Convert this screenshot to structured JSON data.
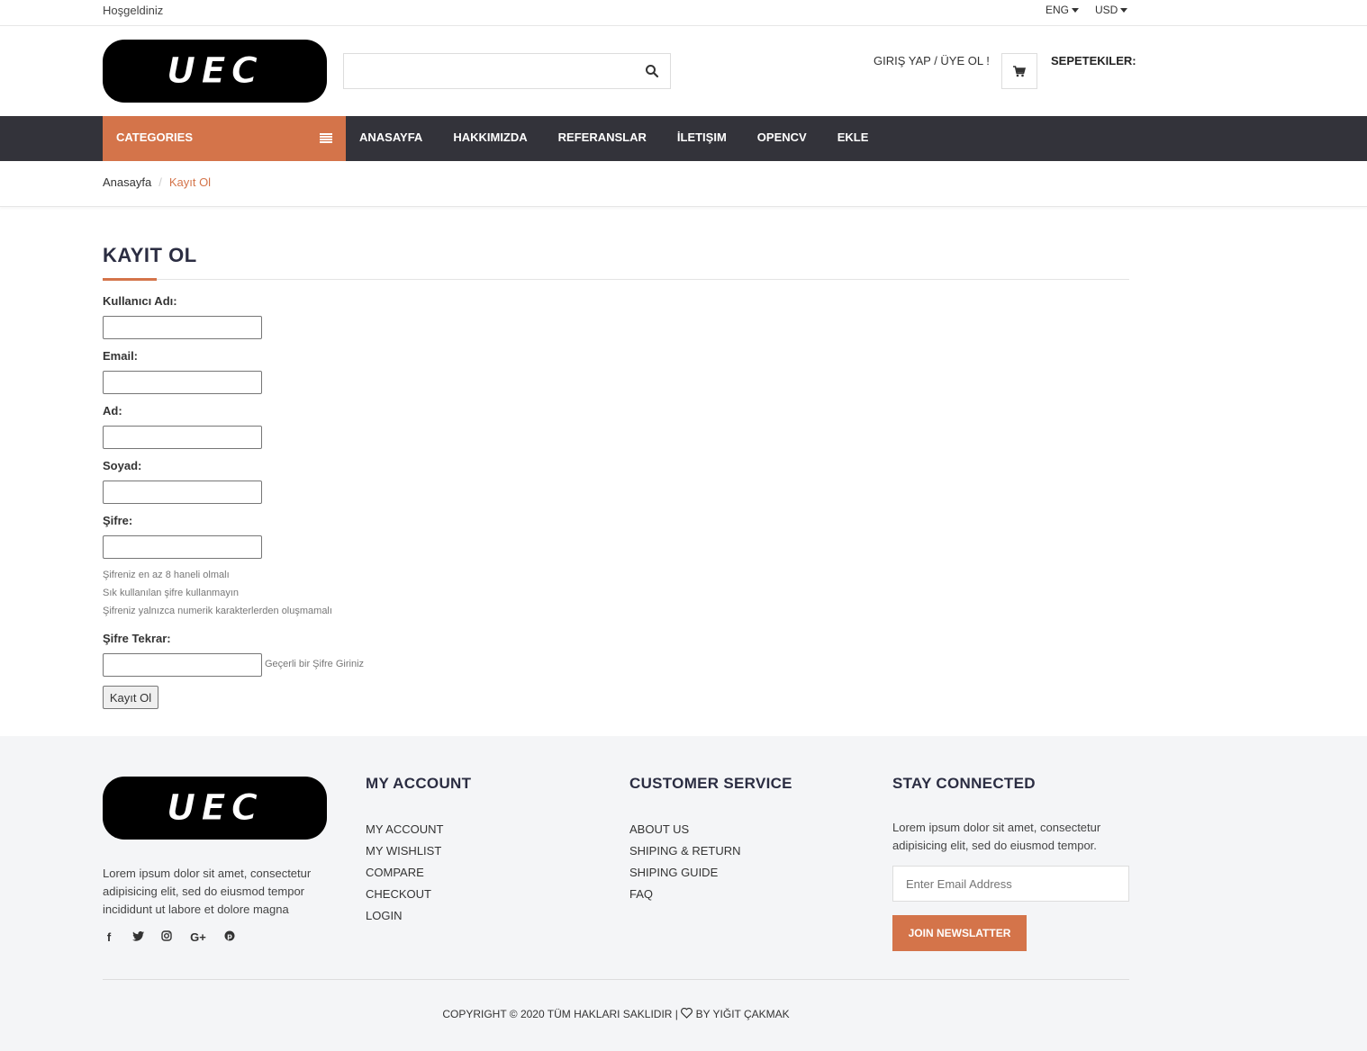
{
  "topbar": {
    "welcome": "Hoşgeldiniz",
    "language": "ENG",
    "currency": "USD"
  },
  "header": {
    "logo_text": "UEC",
    "search_placeholder": "",
    "login_link": "GIRIŞ YAP / ÜYE OL !",
    "cart_label": "SEPETEKILER:"
  },
  "nav": {
    "categories": "CATEGORIES",
    "items": [
      "ANASAYFA",
      "HAKKIMIZDA",
      "REFERANSLAR",
      "İLETIŞIM",
      "OPENCV",
      "EKLE"
    ]
  },
  "breadcrumb": {
    "home": "Anasayfa",
    "separator": "/",
    "current": "Kayıt Ol"
  },
  "form": {
    "title": "KAYIT OL",
    "username_label": "Kullanıcı Adı:",
    "email_label": "Email:",
    "name_label": "Ad:",
    "surname_label": "Soyad:",
    "password_label": "Şifre:",
    "hint1": "Şifreniz en az 8 haneli olmalı",
    "hint2": "Sık kullanılan şifre kullanmayın",
    "hint3": "Şifreniz yalnızca numerik karakterlerden oluşmamalı",
    "password_repeat_label": "Şifre Tekrar:",
    "password_repeat_hint": "Geçerli bir Şifre Giriniz",
    "submit_label": "Kayıt Ol"
  },
  "footer": {
    "logo_text": "UEC",
    "about_text": "Lorem ipsum dolor sit amet, consectetur adipisicing elit, sed do eiusmod tempor incididunt ut labore et dolore magna",
    "my_account": {
      "title": "MY ACCOUNT",
      "links": [
        "MY ACCOUNT",
        "MY WISHLIST",
        "COMPARE",
        "CHECKOUT",
        "LOGIN"
      ]
    },
    "customer_service": {
      "title": "CUSTOMER SERVICE",
      "links": [
        "ABOUT US",
        "SHIPING & RETURN",
        "SHIPING GUIDE",
        "FAQ"
      ]
    },
    "stay_connected": {
      "title": "STAY CONNECTED",
      "text": "Lorem ipsum dolor sit amet, consectetur adipisicing elit, sed do eiusmod tempor.",
      "email_placeholder": "Enter Email Address",
      "button": "JOIN NEWSLATTER"
    },
    "copyright_left": "COPYRIGHT © 2020 TÜM HAKLARI SAKLIDIR |",
    "copyright_right": "BY YIĞIT ÇAKMAK"
  },
  "colors": {
    "accent": "#d4744a",
    "nav_bg": "#33333a",
    "footer_bg": "#f4f5f7"
  },
  "icons": [
    "search-icon",
    "cart-icon",
    "menu-icon",
    "facebook-icon",
    "twitter-icon",
    "instagram-icon",
    "google-plus-icon",
    "pinterest-icon",
    "heart-icon"
  ]
}
